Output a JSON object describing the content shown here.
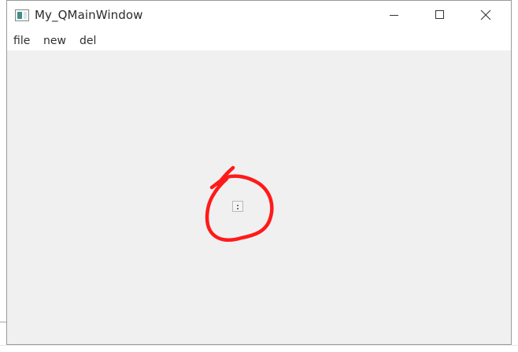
{
  "window": {
    "title": "My_QMainWindow",
    "icon": "app-window-icon"
  },
  "titlebar_controls": {
    "minimize_icon": "minimize-icon",
    "maximize_icon": "maximize-icon",
    "close_icon": "close-icon"
  },
  "menubar": {
    "items": [
      {
        "label": "file"
      },
      {
        "label": "new"
      },
      {
        "label": "del"
      }
    ]
  },
  "central_widget": {
    "item_icon": "empty-widget-icon"
  },
  "annotation": {
    "shape": "hand-drawn-circle",
    "color": "#ff1a1a"
  },
  "colors": {
    "window_background": "#f0f0f0",
    "titlebar_background": "#ffffff",
    "annotation": "#ff1a1a"
  }
}
